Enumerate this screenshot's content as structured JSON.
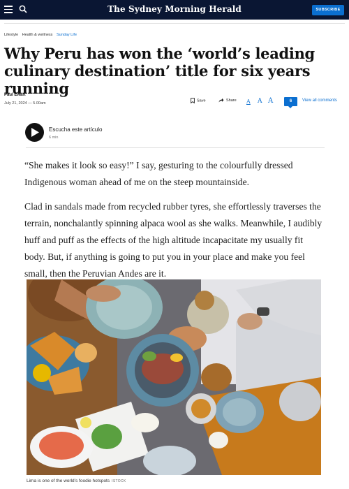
{
  "header": {
    "masthead": "The Sydney Morning Herald",
    "subscribe_label": "SUBSCRIBE"
  },
  "breadcrumbs": [
    "Lifestyle",
    "Health & wellness",
    "Sunday Life"
  ],
  "article": {
    "headline": "Why Peru has won the ‘world’s leading culinary destination’ title for six years running",
    "author": "Paul Ewart",
    "date": "July 21, 2024 — 5.00am",
    "paragraphs": [
      "“She makes it look so easy!” I say, gesturing to the colourfully dressed Indigenous woman ahead of me on the steep mountainside.",
      "Clad in sandals made from recycled rubber tyres, she effortlessly traverses the terrain, nonchalantly spinning alpaca wool as she walks. Meanwhile, I audibly huff and puff as the effects of the high altitude incapacitate my usually fit body. But, if anything is going to put you in your place and make you feel small, then the Peruvian Andes are it."
    ],
    "image_caption": "Lima is one of the world’s foodie hotspots",
    "image_credit": "ISTOCK"
  },
  "tools": {
    "save_label": "Save",
    "share_label": "Share",
    "text_size_labels": [
      "A",
      "A",
      "A"
    ],
    "comments_count": "6",
    "view_comments_label": "View all comments"
  },
  "audio": {
    "listen_label": "Escucha este artículo",
    "duration": "6 min"
  },
  "colors": {
    "topbar": "#0a1633",
    "accent": "#0b6fd0"
  }
}
